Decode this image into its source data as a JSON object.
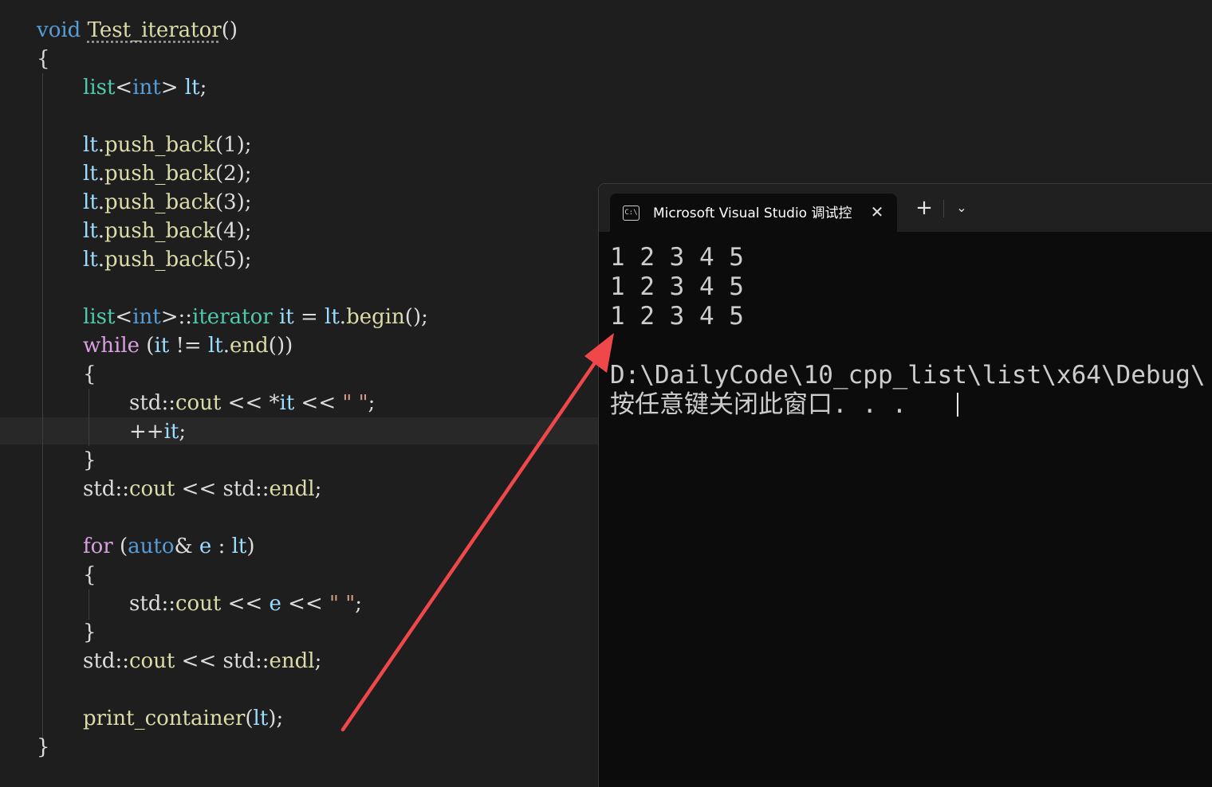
{
  "editor": {
    "code_lines": [
      [
        {
          "t": "void",
          "c": "kw"
        },
        {
          "t": " ",
          "c": "plain"
        },
        {
          "t": "Test_iterator",
          "c": "fn squiggle"
        },
        {
          "t": "()",
          "c": "plain"
        }
      ],
      [
        {
          "t": "{",
          "c": "plain"
        }
      ],
      [
        {
          "t": "list",
          "c": "type"
        },
        {
          "t": "<",
          "c": "plain"
        },
        {
          "t": "int",
          "c": "kw"
        },
        {
          "t": "> ",
          "c": "plain"
        },
        {
          "t": "lt",
          "c": "var"
        },
        {
          "t": ";",
          "c": "plain"
        }
      ],
      [
        {
          "t": "lt",
          "c": "var"
        },
        {
          "t": ".",
          "c": "plain"
        },
        {
          "t": "push_back",
          "c": "fn"
        },
        {
          "t": "(1);",
          "c": "plain"
        }
      ],
      [
        {
          "t": "lt",
          "c": "var"
        },
        {
          "t": ".",
          "c": "plain"
        },
        {
          "t": "push_back",
          "c": "fn"
        },
        {
          "t": "(2);",
          "c": "plain"
        }
      ],
      [
        {
          "t": "lt",
          "c": "var"
        },
        {
          "t": ".",
          "c": "plain"
        },
        {
          "t": "push_back",
          "c": "fn"
        },
        {
          "t": "(3);",
          "c": "plain"
        }
      ],
      [
        {
          "t": "lt",
          "c": "var"
        },
        {
          "t": ".",
          "c": "plain"
        },
        {
          "t": "push_back",
          "c": "fn"
        },
        {
          "t": "(4);",
          "c": "plain"
        }
      ],
      [
        {
          "t": "lt",
          "c": "var"
        },
        {
          "t": ".",
          "c": "plain"
        },
        {
          "t": "push_back",
          "c": "fn"
        },
        {
          "t": "(5);",
          "c": "plain"
        }
      ],
      [
        {
          "t": "list",
          "c": "type"
        },
        {
          "t": "<",
          "c": "plain"
        },
        {
          "t": "int",
          "c": "kw"
        },
        {
          "t": ">::",
          "c": "plain"
        },
        {
          "t": "iterator",
          "c": "type"
        },
        {
          "t": " ",
          "c": "plain"
        },
        {
          "t": "it",
          "c": "var"
        },
        {
          "t": " = ",
          "c": "plain"
        },
        {
          "t": "lt",
          "c": "var"
        },
        {
          "t": ".",
          "c": "plain"
        },
        {
          "t": "begin",
          "c": "fn"
        },
        {
          "t": "();",
          "c": "plain"
        }
      ],
      [
        {
          "t": "while",
          "c": "ctl"
        },
        {
          "t": " (",
          "c": "plain"
        },
        {
          "t": "it",
          "c": "var"
        },
        {
          "t": " != ",
          "c": "plain"
        },
        {
          "t": "lt",
          "c": "var"
        },
        {
          "t": ".",
          "c": "plain"
        },
        {
          "t": "end",
          "c": "fn"
        },
        {
          "t": "())",
          "c": "plain"
        }
      ],
      [
        {
          "t": "{",
          "c": "plain"
        }
      ],
      [
        {
          "t": "std",
          "c": "plain"
        },
        {
          "t": "::",
          "c": "plain"
        },
        {
          "t": "cout",
          "c": "fn"
        },
        {
          "t": " << *",
          "c": "plain"
        },
        {
          "t": "it",
          "c": "var"
        },
        {
          "t": " << ",
          "c": "plain"
        },
        {
          "t": "\" \"",
          "c": "str"
        },
        {
          "t": ";",
          "c": "plain"
        }
      ],
      [
        {
          "t": "++",
          "c": "plain"
        },
        {
          "t": "it",
          "c": "var"
        },
        {
          "t": ";",
          "c": "plain"
        }
      ],
      [
        {
          "t": "}",
          "c": "plain"
        }
      ],
      [
        {
          "t": "std",
          "c": "plain"
        },
        {
          "t": "::",
          "c": "plain"
        },
        {
          "t": "cout",
          "c": "fn"
        },
        {
          "t": " << ",
          "c": "plain"
        },
        {
          "t": "std",
          "c": "plain"
        },
        {
          "t": "::",
          "c": "plain"
        },
        {
          "t": "endl",
          "c": "fn"
        },
        {
          "t": ";",
          "c": "plain"
        }
      ],
      [
        {
          "t": "for",
          "c": "ctl"
        },
        {
          "t": " (",
          "c": "plain"
        },
        {
          "t": "auto",
          "c": "kw"
        },
        {
          "t": "& ",
          "c": "plain"
        },
        {
          "t": "e",
          "c": "var"
        },
        {
          "t": " : ",
          "c": "plain"
        },
        {
          "t": "lt",
          "c": "var"
        },
        {
          "t": ")",
          "c": "plain"
        }
      ],
      [
        {
          "t": "{",
          "c": "plain"
        }
      ],
      [
        {
          "t": "std",
          "c": "plain"
        },
        {
          "t": "::",
          "c": "plain"
        },
        {
          "t": "cout",
          "c": "fn"
        },
        {
          "t": " << ",
          "c": "plain"
        },
        {
          "t": "e",
          "c": "var"
        },
        {
          "t": " << ",
          "c": "plain"
        },
        {
          "t": "\" \"",
          "c": "str"
        },
        {
          "t": ";",
          "c": "plain"
        }
      ],
      [
        {
          "t": "}",
          "c": "plain"
        }
      ],
      [
        {
          "t": "std",
          "c": "plain"
        },
        {
          "t": "::",
          "c": "plain"
        },
        {
          "t": "cout",
          "c": "fn"
        },
        {
          "t": " << ",
          "c": "plain"
        },
        {
          "t": "std",
          "c": "plain"
        },
        {
          "t": "::",
          "c": "plain"
        },
        {
          "t": "endl",
          "c": "fn"
        },
        {
          "t": ";",
          "c": "plain"
        }
      ],
      [
        {
          "t": "print_container",
          "c": "fn"
        },
        {
          "t": "(",
          "c": "plain"
        },
        {
          "t": "lt",
          "c": "var"
        },
        {
          "t": ");",
          "c": "plain"
        }
      ],
      [
        {
          "t": "}",
          "c": "plain"
        }
      ]
    ]
  },
  "console": {
    "tab_title": "Microsoft Visual Studio 调试控制台",
    "tab_icon_text": "C:\\",
    "close_glyph": "✕",
    "new_tab_glyph": "+",
    "dropdown_glyph": "⌄",
    "output_lines": [
      "1 2 3 4 5",
      "1 2 3 4 5",
      "1 2 3 4 5",
      "D:\\DailyCode\\10_cpp_list\\list\\x64\\Debug\\",
      "按任意键关闭此窗口. . ."
    ]
  },
  "colors": {
    "editor_bg": "#1e1e1e",
    "console_bg": "#0c0c0c",
    "annotation_arrow": "#f0484a"
  }
}
